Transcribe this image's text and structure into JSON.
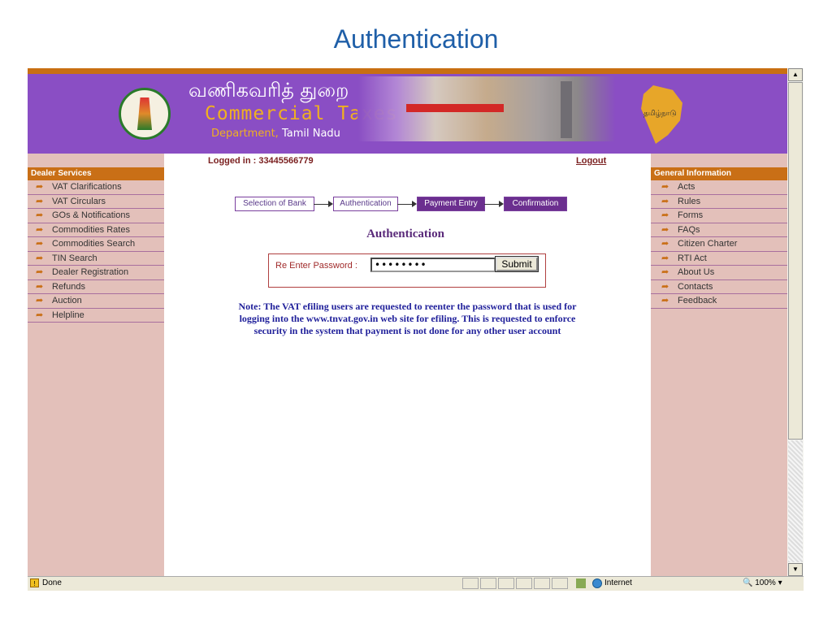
{
  "slide": {
    "title": "Authentication"
  },
  "header": {
    "tamil_title": "வணிகவரித் துறை",
    "brand_main": "Commercial Taxes",
    "brand_sub_department": "Department,",
    "brand_sub_place": "Tamil Nadu",
    "map_label": "தமிழ்நாடு"
  },
  "user": {
    "logged_in": "Logged in : 33445566779",
    "logout": "Logout"
  },
  "left_menu": {
    "title": "Dealer Services",
    "items": [
      {
        "label": "VAT Clarifications"
      },
      {
        "label": "VAT Circulars"
      },
      {
        "label": "GOs & Notifications"
      },
      {
        "label": "Commodities Rates"
      },
      {
        "label": "Commodities Search"
      },
      {
        "label": "TIN Search"
      },
      {
        "label": "Dealer Registration"
      },
      {
        "label": "Refunds"
      },
      {
        "label": "Auction"
      },
      {
        "label": "Helpline"
      }
    ]
  },
  "right_menu": {
    "title": "General Information",
    "items": [
      {
        "label": "Acts"
      },
      {
        "label": "Rules"
      },
      {
        "label": "Forms"
      },
      {
        "label": "FAQs"
      },
      {
        "label": "Citizen Charter"
      },
      {
        "label": "RTI Act"
      },
      {
        "label": "About Us"
      },
      {
        "label": "Contacts"
      },
      {
        "label": "Feedback"
      }
    ]
  },
  "steps": [
    {
      "label": "Selection of Bank"
    },
    {
      "label": "Authentication"
    },
    {
      "label": "Payment Entry"
    },
    {
      "label": "Confirmation"
    }
  ],
  "auth": {
    "heading": "Authentication",
    "password_label": "Re Enter Password :",
    "password_value": "••••••••",
    "submit": "Submit",
    "note": "Note: The VAT efiling users are requested to reenter the password that is used for logging into the www.tnvat.gov.in web site for efiling. This is requested to enforce security in the system that payment is not done for any other user account"
  },
  "statusbar": {
    "status": "Done",
    "zone": "Internet",
    "zoom": "100%"
  },
  "colors": {
    "header": "#8a4ec4",
    "accent": "#c86f12",
    "sidebar": "#e3c0ba",
    "step_active": "#6b2f8f"
  }
}
